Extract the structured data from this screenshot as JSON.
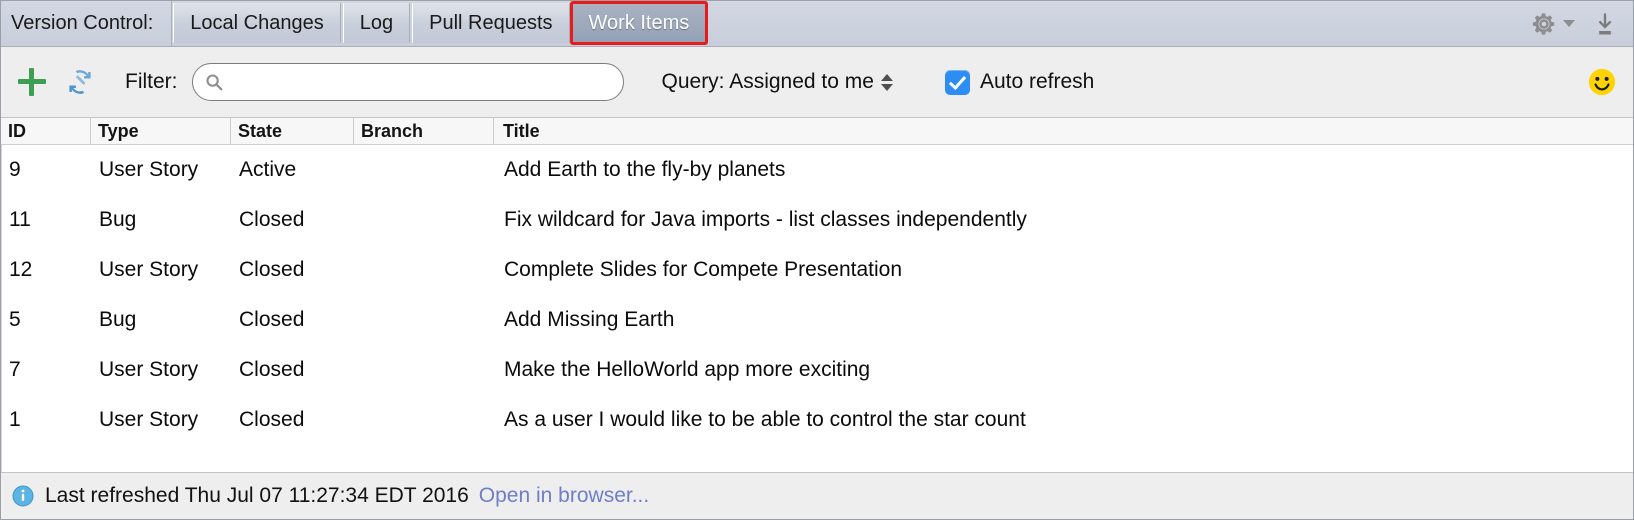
{
  "window": {
    "tabbar": {
      "title": "Version Control:",
      "tabs": [
        {
          "label": "Local Changes",
          "selected": false
        },
        {
          "label": "Log",
          "selected": false
        },
        {
          "label": "Pull Requests",
          "selected": false
        },
        {
          "label": "Work Items",
          "selected": true
        }
      ],
      "tools": [
        {
          "name": "settings-gear-icon",
          "label": "Settings"
        },
        {
          "name": "hide-panel-icon",
          "label": "Hide"
        }
      ],
      "focus_ring_color": "#e81b1b",
      "selected_tab_bg": "#9aa5b9"
    },
    "toolbar": {
      "add_label": "+",
      "add_icon_color": "#3d9f54",
      "refresh_icon_color": "#5f9fd4",
      "filter_label": "Filter:",
      "search": {
        "value": "",
        "placeholder": ""
      },
      "query": {
        "label": "Query: Assigned to me",
        "options": [
          "Assigned to me"
        ]
      },
      "auto_refresh": {
        "label": "Auto refresh",
        "checked": true,
        "accent": "#2c8ef4"
      },
      "smiley_icon": "smiley-face-icon"
    },
    "table": {
      "columns": [
        "ID",
        "Type",
        "State",
        "Branch",
        "Title"
      ],
      "rows": [
        {
          "id": "9",
          "type": "User Story",
          "state": "Active",
          "branch": "",
          "title": "Add Earth to the fly-by planets"
        },
        {
          "id": "11",
          "type": "Bug",
          "state": "Closed",
          "branch": "",
          "title": "Fix wildcard for Java imports - list classes independently"
        },
        {
          "id": "12",
          "type": "User Story",
          "state": "Closed",
          "branch": "",
          "title": "Complete Slides for Compete Presentation"
        },
        {
          "id": "5",
          "type": "Bug",
          "state": "Closed",
          "branch": "",
          "title": "Add Missing Earth"
        },
        {
          "id": "7",
          "type": "User Story",
          "state": "Closed",
          "branch": "",
          "title": "Make the HelloWorld app more exciting"
        },
        {
          "id": "1",
          "type": "User Story",
          "state": "Closed",
          "branch": "",
          "title": "As a user I would like to be able to control the star count"
        }
      ]
    },
    "statusbar": {
      "icon": "info-icon",
      "message": "Last refreshed Thu Jul 07 11:27:34 EDT 2016",
      "link": "Open in browser...",
      "link_color": "#6e7fc9"
    }
  }
}
